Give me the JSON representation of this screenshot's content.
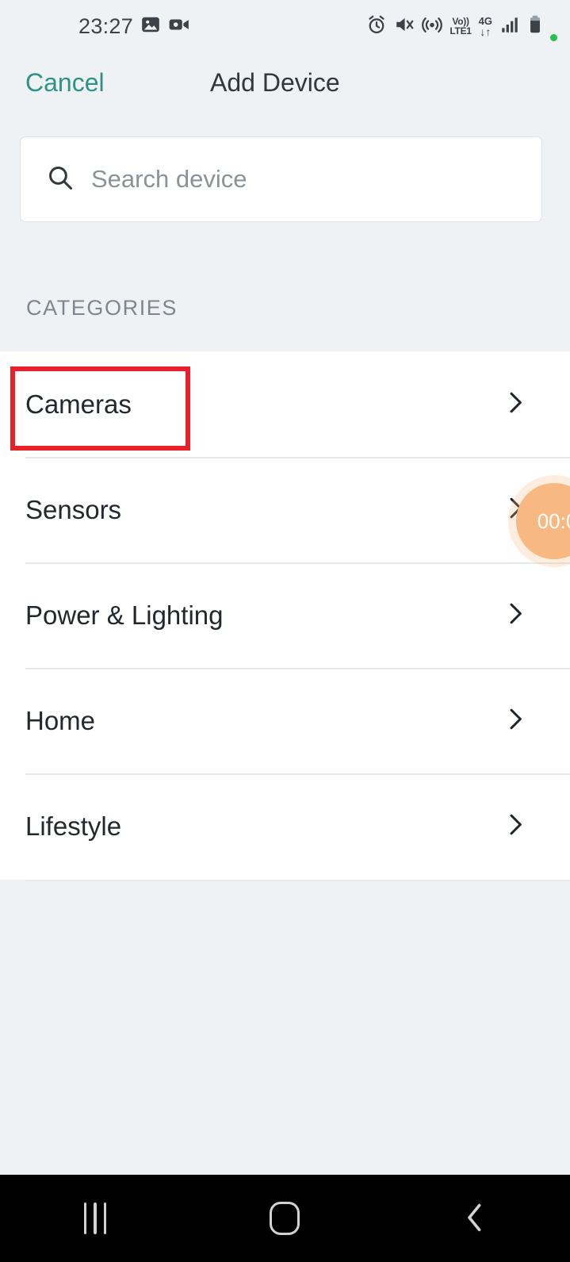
{
  "status_bar": {
    "time": "23:27",
    "left_icons": [
      "image-icon",
      "screen-record-icon"
    ],
    "right_icons": [
      "alarm-icon",
      "mute-vibrate-icon",
      "hotspot-icon",
      "signal-bars-icon",
      "battery-icon",
      "green-dot-indicator"
    ],
    "volte_line1": "Vo))",
    "volte_line2": "LTE1",
    "network_type": "4G",
    "data_arrows": "↓↑"
  },
  "header": {
    "cancel_label": "Cancel",
    "title": "Add Device"
  },
  "search": {
    "placeholder": "Search device",
    "value": "",
    "icon": "search-icon"
  },
  "section": {
    "categories_label": "CATEGORIES"
  },
  "categories": [
    {
      "label": "Cameras",
      "chevron": "chevron-right-icon",
      "highlighted": true
    },
    {
      "label": "Sensors",
      "chevron": "chevron-right-icon",
      "highlighted": false
    },
    {
      "label": "Power & Lighting",
      "chevron": "chevron-right-icon",
      "highlighted": false
    },
    {
      "label": "Home",
      "chevron": "chevron-right-icon",
      "highlighted": false
    },
    {
      "label": "Lifestyle",
      "chevron": "chevron-right-icon",
      "highlighted": false
    }
  ],
  "timer_badge": {
    "text": "00:0",
    "color": "#f7b981"
  },
  "annotation": {
    "target": "Cameras",
    "color": "#e8202a"
  },
  "nav_bar": {
    "recents_label": "recents-icon",
    "home_label": "home-icon",
    "back_label": "back-icon"
  },
  "colors": {
    "background": "#eff2f5",
    "card": "#ffffff",
    "accent": "#2e9384",
    "text_primary": "#22282d",
    "text_secondary": "#7e878f",
    "divider": "#e6e9ec",
    "annotation": "#e8202a",
    "badge": "#f7b981"
  }
}
